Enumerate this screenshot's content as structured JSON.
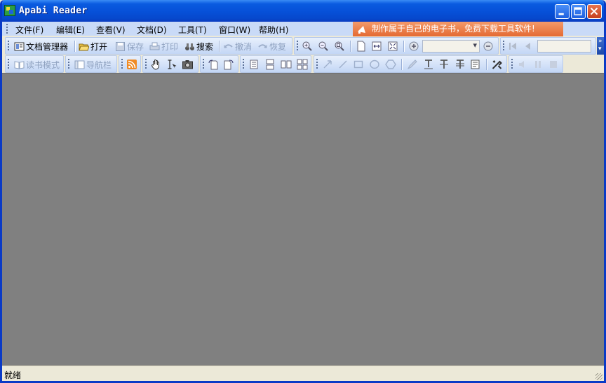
{
  "window": {
    "title": "Apabi Reader"
  },
  "menu": [
    {
      "label": "文件(F)"
    },
    {
      "label": "编辑(E)"
    },
    {
      "label": "查看(V)"
    },
    {
      "label": "文档(D)"
    },
    {
      "label": "工具(T)"
    },
    {
      "label": "窗口(W)"
    },
    {
      "label": "帮助(H)"
    }
  ],
  "ad_banner": "制作属于自己的电子书，免费下载工具软件!",
  "toolbar1": {
    "doc_manager": "文档管理器",
    "open": "打开",
    "save": "保存",
    "print": "打印",
    "search": "搜索",
    "undo": "撤消",
    "redo": "恢复"
  },
  "toolbar2": {
    "reading_mode": "读书模式",
    "nav_bar": "导航栏"
  },
  "zoom_value": "",
  "page_value": "",
  "status": "就绪",
  "colors": {
    "titlebar": "#0650d8",
    "toolbar": "#c9daf7",
    "content": "#808080",
    "ad_banner": "#e46a33"
  }
}
